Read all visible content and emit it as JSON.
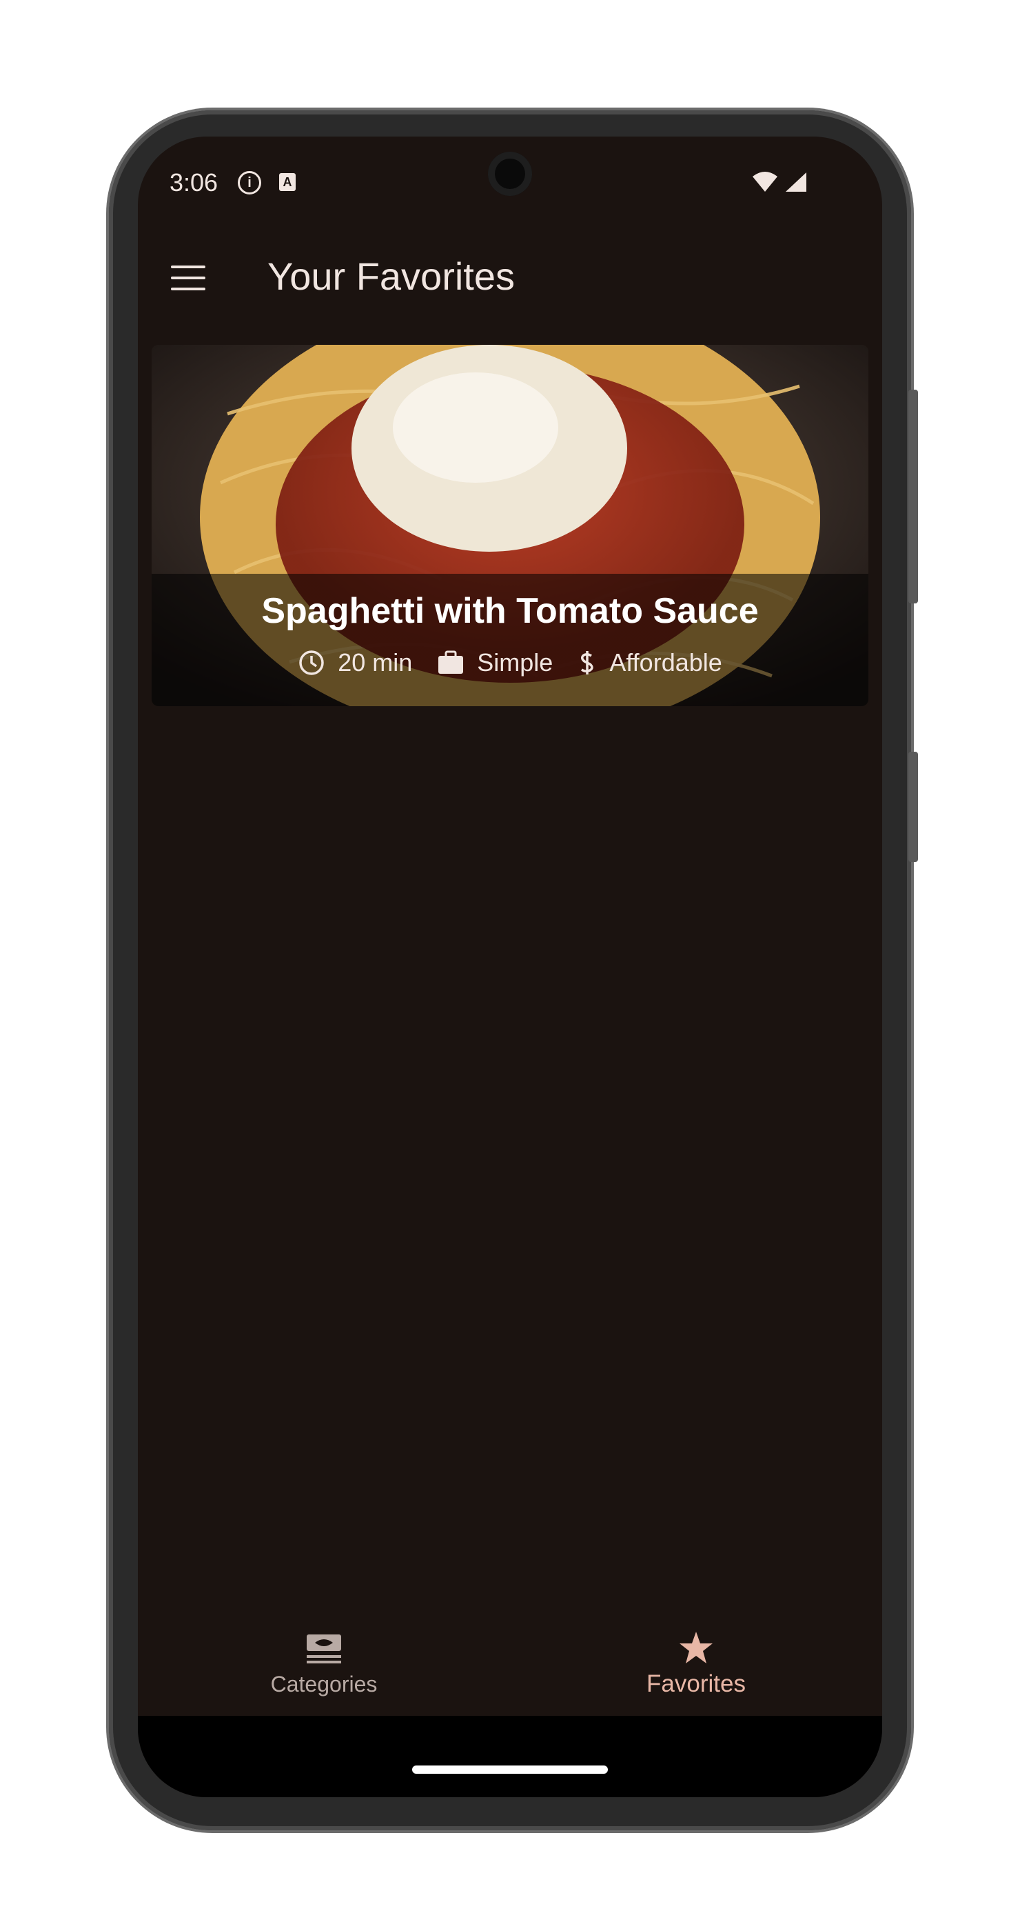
{
  "status_bar": {
    "time": "3:06",
    "icons": [
      "info-icon",
      "a-icon",
      "wifi-icon",
      "signal-icon"
    ]
  },
  "app_bar": {
    "menu_icon": "menu-icon",
    "title": "Your Favorites"
  },
  "favorites": [
    {
      "title": "Spaghetti with Tomato Sauce",
      "duration": "20 min",
      "complexity": "Simple",
      "affordability": "Affordable",
      "icons": [
        "clock-icon",
        "briefcase-icon",
        "dollar-icon"
      ]
    }
  ],
  "bottom_nav": {
    "items": [
      {
        "label": "Categories",
        "icon": "categories-icon",
        "selected": false
      },
      {
        "label": "Favorites",
        "icon": "star-icon",
        "selected": true
      }
    ]
  },
  "colors": {
    "background": "#1b1310",
    "text": "#f1e6e1",
    "accent": "#e8b7a6"
  }
}
